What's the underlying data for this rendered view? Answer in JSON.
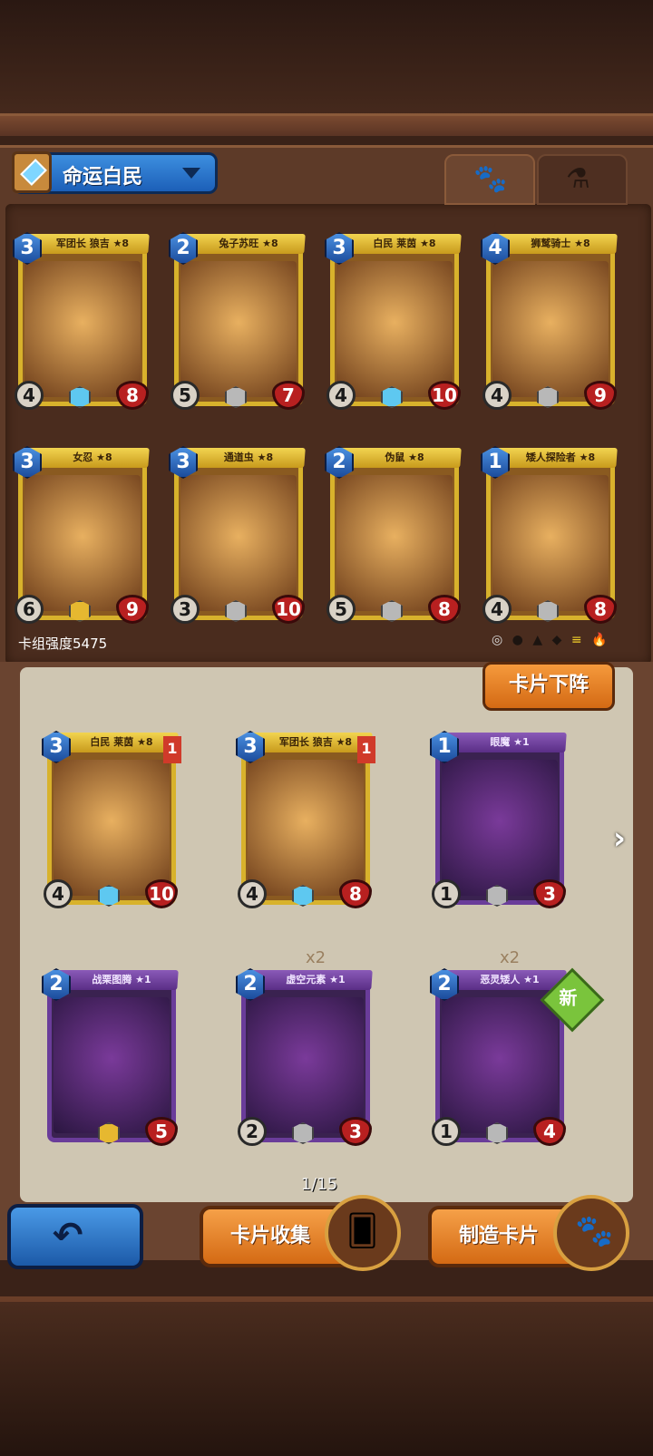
{
  "deck": {
    "name": "命运白民",
    "strength_label": "卡组强度5475",
    "tabs": [
      "paw-icon",
      "potion-icon"
    ]
  },
  "deck_cards": [
    {
      "title": "军团长 狼吉 ★8",
      "cost": "3",
      "atk": "4",
      "hp": "8",
      "gem": "blue"
    },
    {
      "title": "兔子苏旺 ★8",
      "cost": "2",
      "atk": "5",
      "hp": "7",
      "gem": "gray"
    },
    {
      "title": "白民 莱茵 ★8",
      "cost": "3",
      "atk": "4",
      "hp": "10",
      "gem": "blue"
    },
    {
      "title": "狮鹫骑士 ★8",
      "cost": "4",
      "atk": "4",
      "hp": "9",
      "gem": "gray"
    },
    {
      "title": "女忍 ★8",
      "cost": "3",
      "atk": "6",
      "hp": "9",
      "gem": "gold"
    },
    {
      "title": "通道虫 ★8",
      "cost": "3",
      "atk": "3",
      "hp": "10",
      "gem": "gray"
    },
    {
      "title": "伪鼠 ★8",
      "cost": "2",
      "atk": "5",
      "hp": "8",
      "gem": "gray"
    },
    {
      "title": "矮人探险者 ★8",
      "cost": "1",
      "atk": "4",
      "hp": "8",
      "gem": "gray"
    }
  ],
  "collection_cards": [
    {
      "title": "白民 莱茵 ★8",
      "cost": "3",
      "atk": "4",
      "hp": "10",
      "level": "1",
      "gem": "blue",
      "color": "gold"
    },
    {
      "title": "军团长 狼吉 ★8",
      "cost": "3",
      "atk": "4",
      "hp": "8",
      "level": "1",
      "gem": "blue",
      "color": "gold"
    },
    {
      "title": "眼魔 ★1",
      "cost": "1",
      "atk": "1",
      "hp": "3",
      "gem": "gray",
      "color": "purple"
    },
    {
      "title": "战栗图腾 ★1",
      "cost": "2",
      "atk": "",
      "hp": "5",
      "gem": "gold",
      "color": "purple"
    },
    {
      "title": "虚空元素 ★1",
      "cost": "2",
      "atk": "2",
      "hp": "3",
      "gem": "gray",
      "color": "purple",
      "count": "x2"
    },
    {
      "title": "恶灵矮人 ★1",
      "cost": "2",
      "atk": "1",
      "hp": "4",
      "gem": "gray",
      "color": "purple",
      "count": "x2",
      "badge": "新"
    }
  ],
  "filters": [
    "◎",
    "●",
    "▲",
    "◆",
    "≡",
    "🔥"
  ],
  "buttons": {
    "unequip": "卡片下阵",
    "collection": "卡片收集",
    "craft": "制造卡片",
    "back_icon": "back-arrow-icon"
  },
  "pagination": "1/15",
  "colors": {
    "accent_orange": "#f5a048",
    "accent_blue": "#2f78d0",
    "gold_frame": "#d8b22c",
    "purple_frame": "#6a3c9a"
  }
}
